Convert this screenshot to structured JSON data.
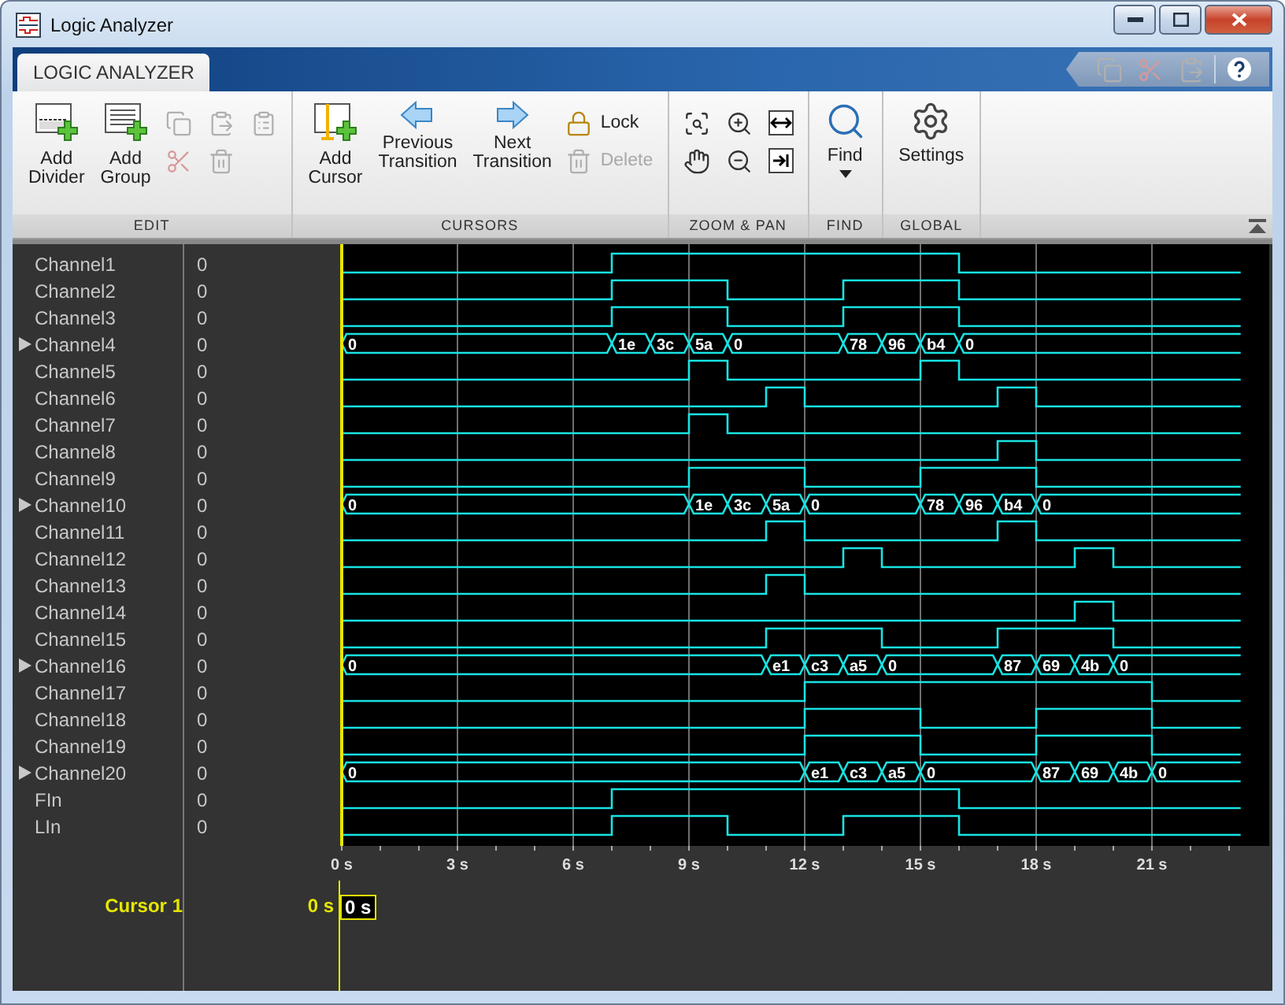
{
  "window": {
    "title": "Logic Analyzer"
  },
  "tabs": [
    {
      "label": "LOGIC ANALYZER",
      "selected": true
    }
  ],
  "quick_access": [
    {
      "kind": "copy",
      "disabled": true
    },
    {
      "kind": "cut",
      "disabled": true
    },
    {
      "kind": "paste",
      "disabled": true
    },
    {
      "kind": "help",
      "disabled": false
    }
  ],
  "toolstrip": [
    {
      "label": "EDIT",
      "large": [
        {
          "kind": "add-divider",
          "label": "Add Divider"
        },
        {
          "kind": "add-group",
          "label": "Add Group"
        }
      ],
      "small": [
        {
          "kind": "copy",
          "disabled": true
        },
        {
          "kind": "cut",
          "disabled": true
        },
        {
          "kind": "paste",
          "disabled": true
        },
        {
          "kind": "delete",
          "disabled": true
        },
        {
          "kind": "paste-special",
          "disabled": true
        }
      ]
    },
    {
      "label": "CURSORS",
      "large": [
        {
          "kind": "add-cursor",
          "label": "Add Cursor"
        },
        {
          "kind": "prev",
          "label": "Previous Transition"
        },
        {
          "kind": "next",
          "label": "Next Transition"
        }
      ],
      "small": [
        {
          "kind": "lock",
          "label": "Lock",
          "disabled": false
        },
        {
          "kind": "delete",
          "label": "Delete",
          "disabled": true
        }
      ]
    },
    {
      "label": "ZOOM & PAN",
      "small": [
        {
          "kind": "zoom-fit",
          "disabled": false
        },
        {
          "kind": "pan",
          "disabled": false
        },
        {
          "kind": "zoom-in",
          "disabled": false
        },
        {
          "kind": "zoom-out",
          "disabled": false
        },
        {
          "kind": "fit-horizontal",
          "disabled": false
        },
        {
          "kind": "jump",
          "disabled": false
        }
      ]
    },
    {
      "label": "FIND",
      "large": [
        {
          "kind": "find",
          "label": "Find"
        }
      ]
    },
    {
      "label": "GLOBAL",
      "large": [
        {
          "kind": "settings",
          "label": "Settings"
        }
      ]
    }
  ],
  "channels": [
    {
      "name": "Channel1",
      "value": "0",
      "kind": "bit"
    },
    {
      "name": "Channel2",
      "value": "0",
      "kind": "bit"
    },
    {
      "name": "Channel3",
      "value": "0",
      "kind": "bit"
    },
    {
      "name": "Channel4",
      "value": "0",
      "kind": "bus",
      "expanded": false,
      "segments": [
        "0",
        "1e",
        "3c",
        "5a",
        "0",
        "78",
        "96",
        "b4",
        "0"
      ]
    },
    {
      "name": "Channel5",
      "value": "0",
      "kind": "bit"
    },
    {
      "name": "Channel6",
      "value": "0",
      "kind": "bit"
    },
    {
      "name": "Channel7",
      "value": "0",
      "kind": "bit"
    },
    {
      "name": "Channel8",
      "value": "0",
      "kind": "bit"
    },
    {
      "name": "Channel9",
      "value": "0",
      "kind": "bit"
    },
    {
      "name": "Channel10",
      "value": "0",
      "kind": "bus",
      "expanded": false,
      "segments": [
        "0",
        "1e",
        "3c",
        "5a",
        "0",
        "78",
        "96",
        "b4",
        "0"
      ]
    },
    {
      "name": "Channel11",
      "value": "0",
      "kind": "bit"
    },
    {
      "name": "Channel12",
      "value": "0",
      "kind": "bit"
    },
    {
      "name": "Channel13",
      "value": "0",
      "kind": "bit"
    },
    {
      "name": "Channel14",
      "value": "0",
      "kind": "bit"
    },
    {
      "name": "Channel15",
      "value": "0",
      "kind": "bit"
    },
    {
      "name": "Channel16",
      "value": "0",
      "kind": "bus",
      "expanded": false,
      "segments": [
        "0",
        "e1",
        "c3",
        "a5",
        "0",
        "87",
        "69",
        "4b",
        "0"
      ]
    },
    {
      "name": "Channel17",
      "value": "0",
      "kind": "bit"
    },
    {
      "name": "Channel18",
      "value": "0",
      "kind": "bit"
    },
    {
      "name": "Channel19",
      "value": "0",
      "kind": "bit"
    },
    {
      "name": "Channel20",
      "value": "0",
      "kind": "bus",
      "expanded": false,
      "segments": [
        "0",
        "e1",
        "c3",
        "a5",
        "0",
        "87",
        "69",
        "4b",
        "0"
      ]
    },
    {
      "name": "FIn",
      "value": "0",
      "kind": "bit"
    },
    {
      "name": "LIn",
      "value": "0",
      "kind": "bit"
    }
  ],
  "time_axis": {
    "ticks": [
      "0 s",
      "3 s",
      "6 s",
      "9 s",
      "12 s",
      "15 s",
      "18 s",
      "21 s"
    ]
  },
  "cursors": [
    {
      "label": "Cursor 1",
      "value": "0 s",
      "marker": "0 s"
    }
  ]
}
